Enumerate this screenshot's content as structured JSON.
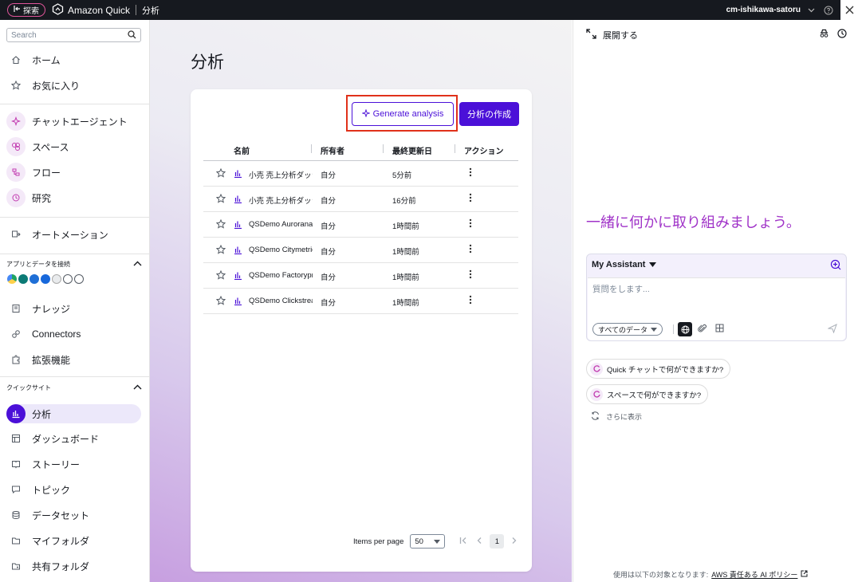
{
  "topbar": {
    "explore_label": "探索",
    "brand": "Amazon Quick",
    "section": "分析",
    "user": "cm-ishikawa-satoru"
  },
  "sidebar": {
    "search_placeholder": "Search",
    "items_top": [
      {
        "label": "ホーム",
        "icon": "home-icon"
      },
      {
        "label": "お気に入り",
        "icon": "star-icon"
      }
    ],
    "items_agent": [
      {
        "label": "チャットエージェント",
        "icon": "sparkle-icon"
      },
      {
        "label": "スペース",
        "icon": "spaces-icon"
      },
      {
        "label": "フロー",
        "icon": "flow-icon"
      },
      {
        "label": "研究",
        "icon": "research-icon"
      }
    ],
    "automation": "オートメーション",
    "apps_section": "アプリとデータを接続",
    "items_data": [
      {
        "label": "ナレッジ",
        "icon": "knowledge-icon"
      },
      {
        "label": "Connectors",
        "icon": "connectors-icon"
      },
      {
        "label": "拡張機能",
        "icon": "puzzle-icon"
      }
    ],
    "quicksight_section": "クイックサイト",
    "items_quicksight": [
      {
        "label": "分析",
        "icon": "analysis-icon",
        "active": true
      },
      {
        "label": "ダッシュボード",
        "icon": "dashboard-icon"
      },
      {
        "label": "ストーリー",
        "icon": "story-icon"
      },
      {
        "label": "トピック",
        "icon": "topic-icon"
      },
      {
        "label": "データセット",
        "icon": "dataset-icon"
      },
      {
        "label": "マイフォルダ",
        "icon": "folder-icon"
      },
      {
        "label": "共有フォルダ",
        "icon": "shared-folder-icon"
      }
    ]
  },
  "main": {
    "title": "分析",
    "generate_label": "Generate analysis",
    "create_label": "分析の作成",
    "columns": [
      "名前",
      "所有者",
      "最終更新日",
      "アクション"
    ],
    "rows": [
      {
        "name": "小売 売上分析ダッシュボード",
        "owner": "自分",
        "updated": "5分前"
      },
      {
        "name": "小売 売上分析ダッシュボード",
        "owner": "自分",
        "updated": "16分前"
      },
      {
        "name": "QSDemo Auroraname",
        "owner": "自分",
        "updated": "1時間前"
      },
      {
        "name": "QSDemo Citymetrics",
        "owner": "自分",
        "updated": "1時間前"
      },
      {
        "name": "QSDemo Factoryprod",
        "owner": "自分",
        "updated": "1時間前"
      },
      {
        "name": "QSDemo Clickstream",
        "owner": "自分",
        "updated": "1時間前"
      }
    ],
    "pager": {
      "label": "Items per page",
      "per_page": "50",
      "page": "1"
    }
  },
  "panel": {
    "expand_label": "展開する",
    "headline": "一緒に何かに取り組みましょう。",
    "assistant_name": "My Assistant",
    "input_placeholder": "質問をします...",
    "data_selector": "すべてのデータ",
    "suggestions": [
      "Quick チャットで何ができますか?",
      "スペースで何ができますか?"
    ],
    "more_label": "さらに表示",
    "footer_text": "使用は以下の対象となります:",
    "footer_link": "AWS 責任ある AI ポリシー"
  },
  "colors": {
    "accent": "#4b10d8",
    "highlight": "#e0311a",
    "headline": "#a033c8",
    "topbar": "#16191f"
  }
}
